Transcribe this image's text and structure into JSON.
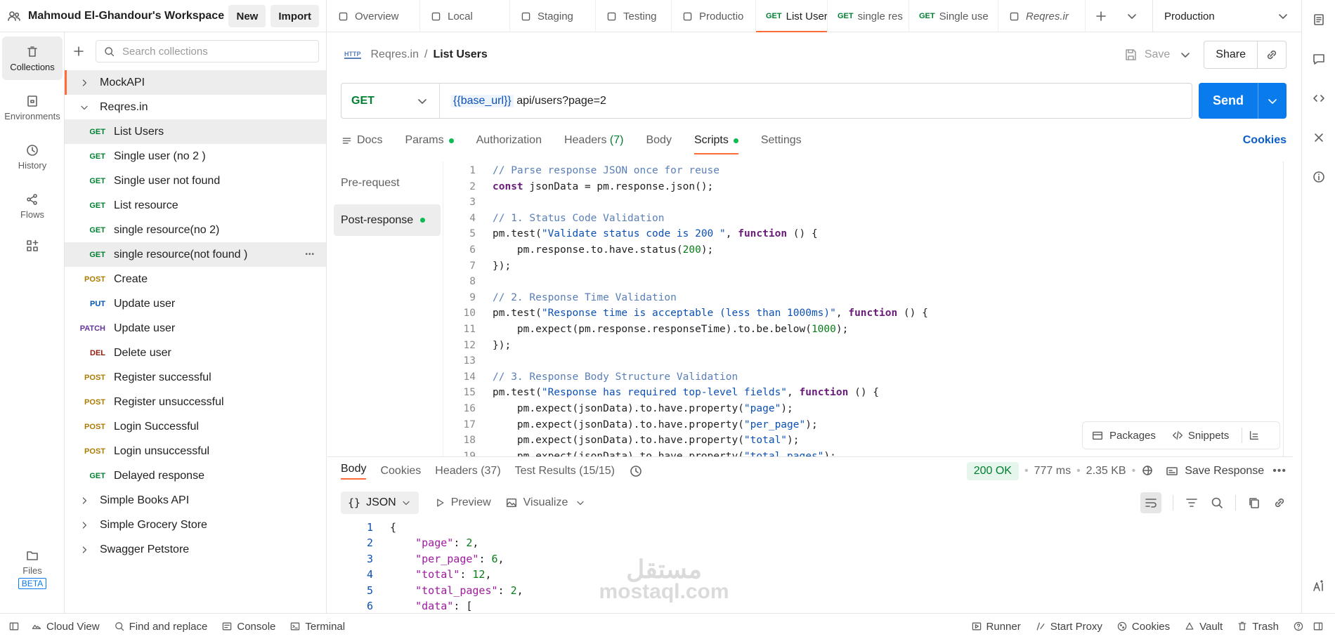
{
  "workspace": {
    "name": "Mahmoud El-Ghandour's Workspace",
    "new_label": "New",
    "import_label": "Import"
  },
  "tabs": [
    {
      "label": "Overview",
      "method": ""
    },
    {
      "label": "Local",
      "method": ""
    },
    {
      "label": "Staging",
      "method": ""
    },
    {
      "label": "Testing",
      "method": ""
    },
    {
      "label": "Productio",
      "method": ""
    },
    {
      "label": "List User",
      "method": "GET"
    },
    {
      "label": "single res",
      "method": "GET"
    },
    {
      "label": "Single use",
      "method": "GET"
    },
    {
      "label": "Reqres.ir",
      "method": ""
    }
  ],
  "environment": "Production",
  "rail": {
    "collections": "Collections",
    "environments": "Environments",
    "history": "History",
    "flows": "Flows",
    "files": "Files",
    "beta": "BETA"
  },
  "search_placeholder": "Search collections",
  "tree": {
    "mockapi": "MockAPI",
    "reqres": "Reqres.in",
    "requests": [
      {
        "method": "GET",
        "label": "List Users"
      },
      {
        "method": "GET",
        "label": "Single user (no 2 )"
      },
      {
        "method": "GET",
        "label": "Single user not found"
      },
      {
        "method": "GET",
        "label": "List resource"
      },
      {
        "method": "GET",
        "label": "single resource(no 2)"
      },
      {
        "method": "GET",
        "label": "single resource(not found )"
      },
      {
        "method": "POST",
        "label": "Create"
      },
      {
        "method": "PUT",
        "label": "Update user"
      },
      {
        "method": "PATCH",
        "label": "Update user"
      },
      {
        "method": "DEL",
        "label": "Delete user"
      },
      {
        "method": "POST",
        "label": "Register successful"
      },
      {
        "method": "POST",
        "label": "Register unsuccessful"
      },
      {
        "method": "POST",
        "label": "Login Successful"
      },
      {
        "method": "POST",
        "label": "Login unsuccessful"
      },
      {
        "method": "GET",
        "label": "Delayed response"
      }
    ],
    "others": [
      "Simple Books API",
      "Simple Grocery Store",
      "Swagger Petstore"
    ]
  },
  "breadcrumb": {
    "collection": "Reqres.in",
    "sep": "/",
    "request": "List Users"
  },
  "save_label": "Save",
  "share_label": "Share",
  "request": {
    "method": "GET",
    "url_var": "{{base_url}}",
    "url_path": " api/users?page=2",
    "send": "Send"
  },
  "req_tabs": {
    "docs": "Docs",
    "params": "Params",
    "auth": "Authorization",
    "headers": "Headers",
    "headers_count": "(7)",
    "body": "Body",
    "scripts": "Scripts",
    "settings": "Settings",
    "cookies": "Cookies"
  },
  "script_side": {
    "pre": "Pre-request",
    "post": "Post-response"
  },
  "code_lines": [
    [
      [
        "cm",
        "// Parse response JSON once for reuse"
      ]
    ],
    [
      [
        "kw2",
        "const"
      ],
      [
        "t",
        " jsonData = pm.response.json();"
      ]
    ],
    [],
    [
      [
        "cm",
        "// 1. Status Code Validation"
      ]
    ],
    [
      [
        "t",
        "pm.test("
      ],
      [
        "str",
        "\"Validate status code is 200 \""
      ],
      [
        "t",
        ", "
      ],
      [
        "kw",
        "function"
      ],
      [
        "t",
        " () {"
      ]
    ],
    [
      [
        "t",
        "    pm.response.to.have.status("
      ],
      [
        "num",
        "200"
      ],
      [
        "t",
        ");"
      ]
    ],
    [
      [
        "t",
        "});"
      ]
    ],
    [],
    [
      [
        "cm",
        "// 2. Response Time Validation"
      ]
    ],
    [
      [
        "t",
        "pm.test("
      ],
      [
        "str",
        "\"Response time is acceptable (less than 1000ms)\""
      ],
      [
        "t",
        ", "
      ],
      [
        "kw",
        "function"
      ],
      [
        "t",
        " () {"
      ]
    ],
    [
      [
        "t",
        "    pm.expect(pm.response.responseTime).to.be.below("
      ],
      [
        "num",
        "1000"
      ],
      [
        "t",
        ");"
      ]
    ],
    [
      [
        "t",
        "});"
      ]
    ],
    [],
    [
      [
        "cm",
        "// 3. Response Body Structure Validation"
      ]
    ],
    [
      [
        "t",
        "pm.test("
      ],
      [
        "str",
        "\"Response has required top-level fields\""
      ],
      [
        "t",
        ", "
      ],
      [
        "kw",
        "function"
      ],
      [
        "t",
        " () {"
      ]
    ],
    [
      [
        "t",
        "    pm.expect(jsonData).to.have.property("
      ],
      [
        "str",
        "\"page\""
      ],
      [
        "t",
        ");"
      ]
    ],
    [
      [
        "t",
        "    pm.expect(jsonData).to.have.property("
      ],
      [
        "str",
        "\"per_page\""
      ],
      [
        "t",
        ");"
      ]
    ],
    [
      [
        "t",
        "    pm.expect(jsonData).to.have.property("
      ],
      [
        "str",
        "\"total\""
      ],
      [
        "t",
        ");"
      ]
    ],
    [
      [
        "t",
        "    pm.expect(jsonData).to.have.property("
      ],
      [
        "str",
        "\"total_pages\""
      ],
      [
        "t",
        ");"
      ]
    ]
  ],
  "snippets": {
    "packages": "Packages",
    "snippets": "Snippets"
  },
  "response": {
    "body": "Body",
    "cookies": "Cookies",
    "headers": "Headers (37)",
    "tests": "Test Results (15/15)",
    "status": "200 OK",
    "time": "777 ms",
    "size": "2.35 KB",
    "save": "Save Response",
    "format": "JSON",
    "preview": "Preview",
    "visualize": "Visualize"
  },
  "json_lines": [
    [
      [
        "t",
        "{"
      ]
    ],
    [
      [
        "t",
        "    "
      ],
      [
        "key",
        "\"page\""
      ],
      [
        "t",
        ": "
      ],
      [
        "jn",
        "2"
      ],
      [
        "t",
        ","
      ]
    ],
    [
      [
        "t",
        "    "
      ],
      [
        "key",
        "\"per_page\""
      ],
      [
        "t",
        ": "
      ],
      [
        "jn",
        "6"
      ],
      [
        "t",
        ","
      ]
    ],
    [
      [
        "t",
        "    "
      ],
      [
        "key",
        "\"total\""
      ],
      [
        "t",
        ": "
      ],
      [
        "jn",
        "12"
      ],
      [
        "t",
        ","
      ]
    ],
    [
      [
        "t",
        "    "
      ],
      [
        "key",
        "\"total_pages\""
      ],
      [
        "t",
        ": "
      ],
      [
        "jn",
        "2"
      ],
      [
        "t",
        ","
      ]
    ],
    [
      [
        "t",
        "    "
      ],
      [
        "key",
        "\"data\""
      ],
      [
        "t",
        ": ["
      ]
    ]
  ],
  "footer": {
    "cloud": "Cloud View",
    "find": "Find and replace",
    "console": "Console",
    "terminal": "Terminal",
    "runner": "Runner",
    "proxy": "Start Proxy",
    "cookies": "Cookies",
    "vault": "Vault",
    "trash": "Trash"
  },
  "watermark": {
    "ar": "مستقل",
    "en": "mostaql.com"
  },
  "colors": {
    "accent": "#ff6c37",
    "send": "#097bed",
    "get": "#007f31",
    "post": "#ad7a03",
    "put": "#0053b8",
    "patch": "#623497",
    "del": "#8e1a10"
  }
}
